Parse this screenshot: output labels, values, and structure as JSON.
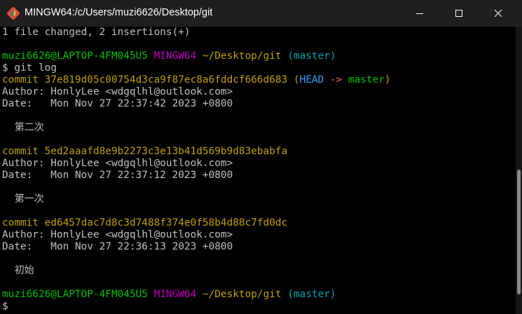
{
  "window": {
    "title": "MINGW64:/c/Users/muzi6626/Desktop/git",
    "app_icon": "git-bash-icon",
    "controls": [
      "minimize-icon",
      "maximize-icon",
      "close-icon"
    ]
  },
  "colors": {
    "background": "#000000",
    "text": "#c0c0c0",
    "user_host": "#00c000",
    "mingw": "#c000c0",
    "path": "#c0a000",
    "branch": "#00a6b2",
    "commit_hash": "#c0a000",
    "head": "#40a0ff",
    "master_ref": "#00c000"
  },
  "terminal": {
    "summary": "1 file changed, 2 insertions(+)",
    "prompt1": {
      "user_host": "muzi6626@LAPTOP-4FM045U5",
      "system": "MINGW64",
      "path": "~/Desktop/git",
      "branch": "(master)",
      "symbol": "$",
      "command": "git log"
    },
    "commits": [
      {
        "label": "commit",
        "hash": "37e819d05c00754d3ca9f87ec8a6fddcf666d683",
        "ref_open": "(",
        "head": "HEAD",
        "arrow": "->",
        "branch": "master",
        "ref_close": ")",
        "author": "Author: HonlyLee <wdgqlhl@outlook.com>",
        "date": "Date:   Mon Nov 27 22:37:42 2023 +0800",
        "message": "    第二次"
      },
      {
        "label": "commit",
        "hash": "5ed2aaafd8e9b2273c3e13b41d569b9d83ebabfa",
        "author": "Author: HonlyLee <wdgqlhl@outlook.com>",
        "date": "Date:   Mon Nov 27 22:37:12 2023 +0800",
        "message": "    第一次"
      },
      {
        "label": "commit",
        "hash": "ed6457dac7d8c3d7488f374e0f58b4d88c7fd0dc",
        "author": "Author: HonlyLee <wdgqlhl@outlook.com>",
        "date": "Date:   Mon Nov 27 22:36:13 2023 +0800",
        "message": "    初始"
      }
    ],
    "prompt2": {
      "user_host": "muzi6626@LAPTOP-4FM045U5",
      "system": "MINGW64",
      "path": "~/Desktop/git",
      "branch": "(master)",
      "symbol": "$"
    }
  }
}
